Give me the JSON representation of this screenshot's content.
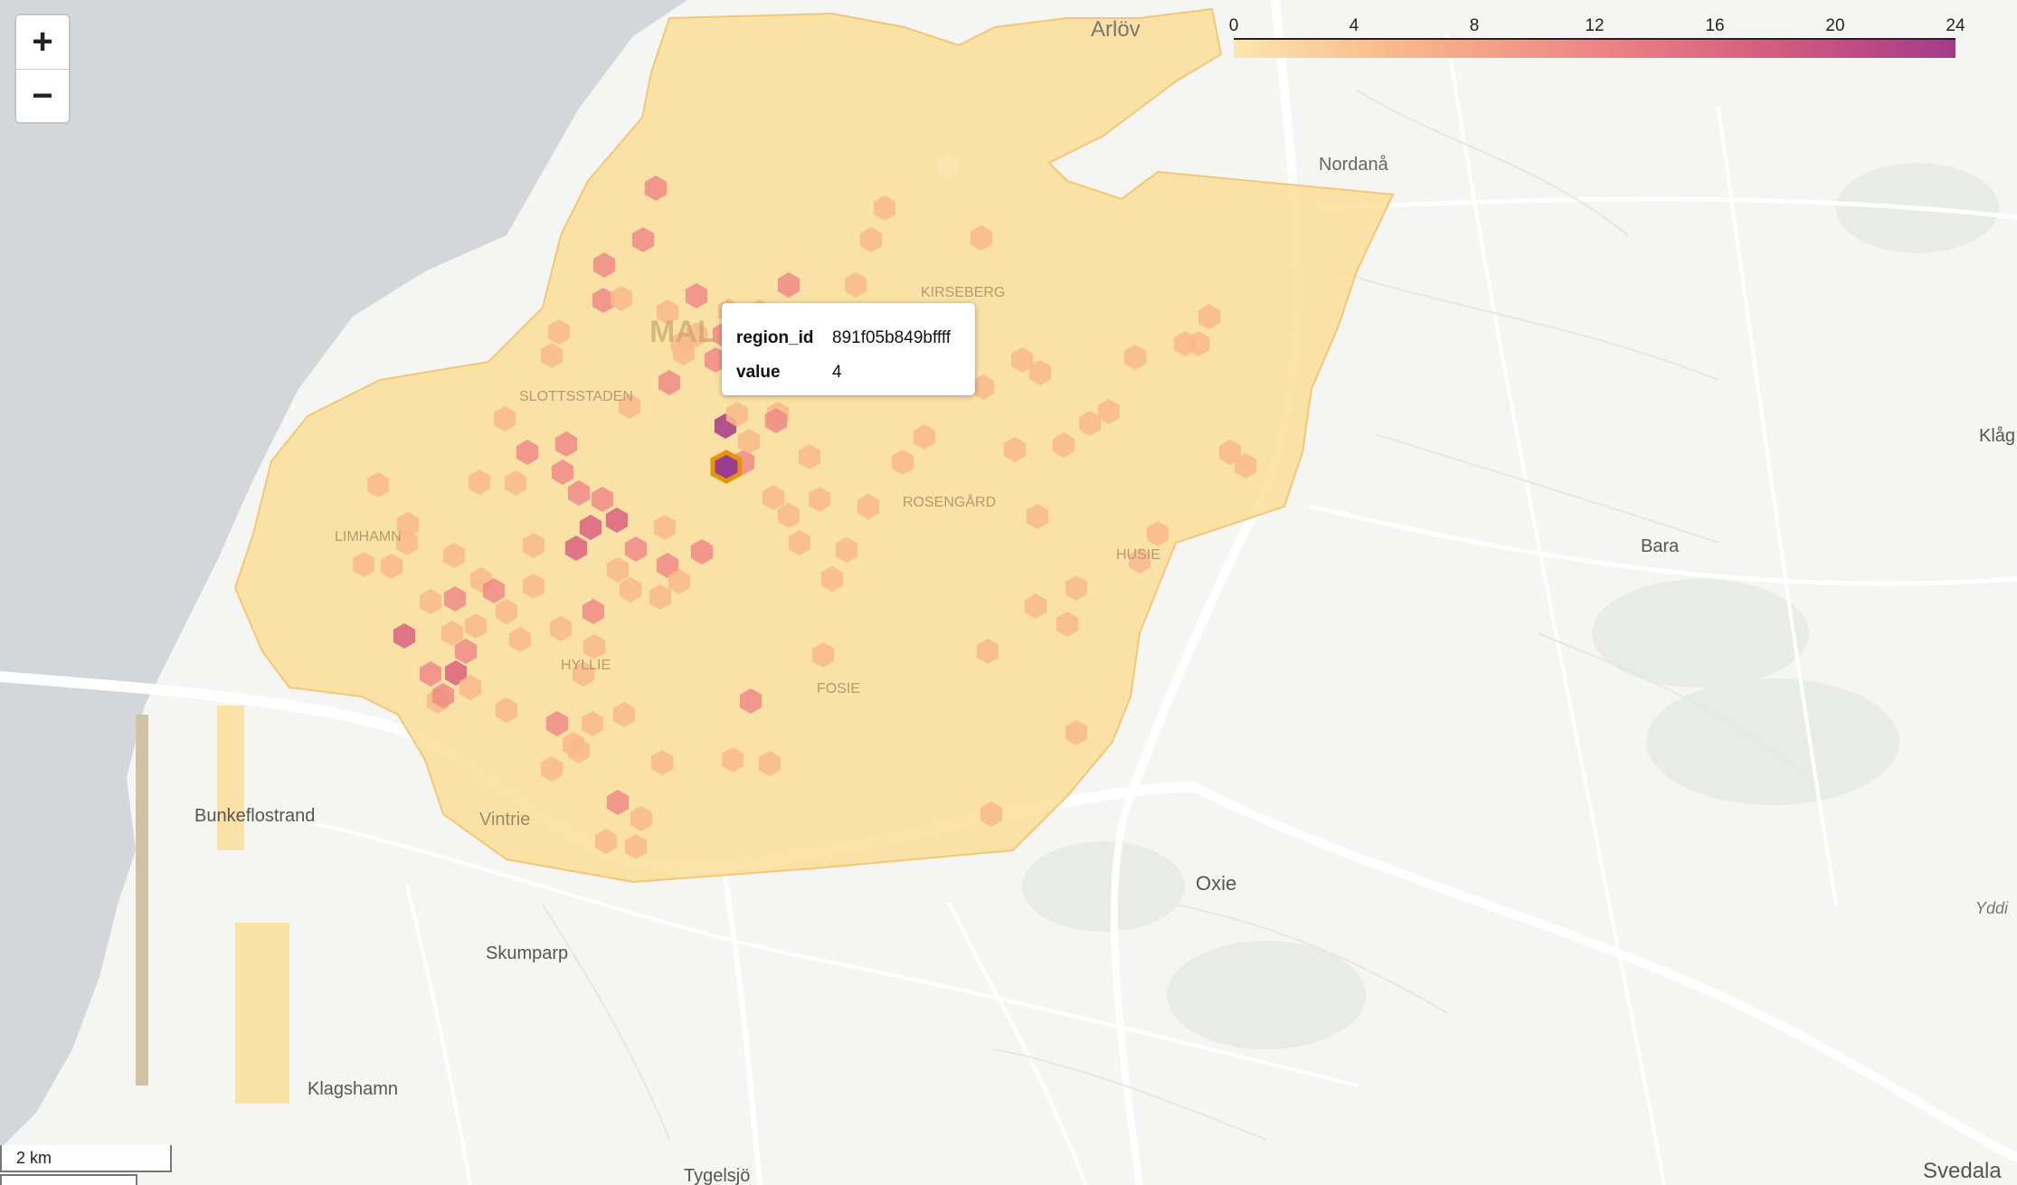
{
  "zoom": {
    "in_label": "+",
    "out_label": "−"
  },
  "legend": {
    "min": 0,
    "max": 24,
    "ticks": [
      "0",
      "4",
      "8",
      "12",
      "16",
      "20",
      "24"
    ],
    "colors": [
      "#fbe6b0",
      "#f9b98b",
      "#ee8a86",
      "#d8607e",
      "#a43a8a"
    ]
  },
  "tooltip": {
    "region_id_label": "region_id",
    "region_id_value": "891f05b849bffff",
    "value_label": "value",
    "value_value": "4"
  },
  "scale": {
    "label": "2 km"
  },
  "places": {
    "arlov": "Arlöv",
    "nordana": "Nordanå",
    "kirseberg": "KIRSEBERG",
    "malmo": "MAL",
    "slottsstaden": "SLOTTSSTADEN",
    "rosengard": "ROSENGÅRD",
    "husie": "HUSIE",
    "limhamn": "LIMHAMN",
    "hyllie": "HYLLIE",
    "fosie": "FOSIE",
    "vintrie": "Vintrie",
    "bunkeflostrand": "Bunkeflostrand",
    "oxie": "Oxie",
    "skumparp": "Skumparp",
    "klagshamn": "Klagshamn",
    "tygelsjo": "Tygelsjö",
    "bara": "Bara",
    "klagerup": "Klåg",
    "svedala": "Svedala",
    "yddingen": "Yddi"
  },
  "colors": {
    "water": "#d3d7da",
    "land": "#f5f5f3",
    "road": "#ffffff",
    "area": "#fbd98b",
    "highlight": "#e8930c"
  }
}
